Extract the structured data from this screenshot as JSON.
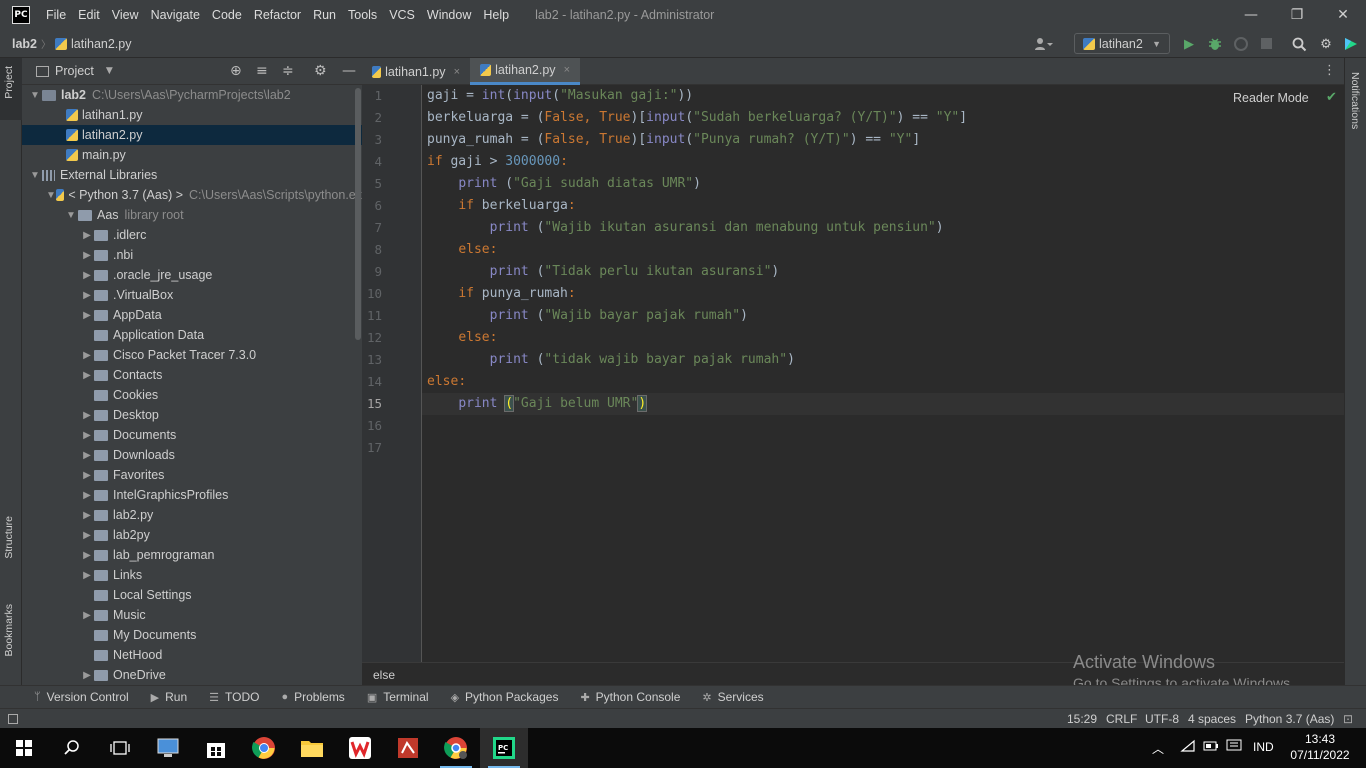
{
  "titlebar": {
    "logo": "PC",
    "menu": [
      "File",
      "Edit",
      "View",
      "Navigate",
      "Code",
      "Refactor",
      "Run",
      "Tools",
      "VCS",
      "Window",
      "Help"
    ],
    "window_title": "lab2 - latihan2.py - Administrator",
    "minimize": "—",
    "restore": "❐",
    "close": "✕"
  },
  "navbar": {
    "project": "lab2",
    "separator": "〉",
    "file": "latihan2.py",
    "run_config": "latihan2"
  },
  "left_strip": {
    "project": "Project",
    "structure": "Structure",
    "bookmarks": "Bookmarks"
  },
  "right_strip": {
    "notifications": "Notifications"
  },
  "project_panel": {
    "title": "Project",
    "rows": [
      {
        "name": "lab2",
        "path": "C:\\Users\\Aas\\PycharmProjects\\lab2"
      },
      {
        "name": "latihan1.py"
      },
      {
        "name": "latihan2.py"
      },
      {
        "name": "main.py"
      },
      {
        "name": "External Libraries"
      },
      {
        "name": "< Python 3.7 (Aas) >",
        "path": "C:\\Users\\Aas\\Scripts\\python.ex"
      },
      {
        "name": "Aas",
        "path": "library root"
      },
      {
        "name": ".idlerc"
      },
      {
        "name": ".nbi"
      },
      {
        "name": ".oracle_jre_usage"
      },
      {
        "name": ".VirtualBox"
      },
      {
        "name": "AppData"
      },
      {
        "name": "Application Data"
      },
      {
        "name": "Cisco Packet Tracer 7.3.0"
      },
      {
        "name": "Contacts"
      },
      {
        "name": "Cookies"
      },
      {
        "name": "Desktop"
      },
      {
        "name": "Documents"
      },
      {
        "name": "Downloads"
      },
      {
        "name": "Favorites"
      },
      {
        "name": "IntelGraphicsProfiles"
      },
      {
        "name": "lab2.py"
      },
      {
        "name": "lab2py"
      },
      {
        "name": "lab_pemrograman"
      },
      {
        "name": "Links"
      },
      {
        "name": "Local Settings"
      },
      {
        "name": "Music"
      },
      {
        "name": "My Documents"
      },
      {
        "name": "NetHood"
      },
      {
        "name": "OneDrive"
      }
    ]
  },
  "tabs": [
    {
      "label": "latihan1.py",
      "close": "×"
    },
    {
      "label": "latihan2.py",
      "close": "×"
    }
  ],
  "editor": {
    "reader_mode": "Reader Mode",
    "current_line": 15,
    "line_numbers": [
      "1",
      "2",
      "3",
      "4",
      "5",
      "6",
      "7",
      "8",
      "9",
      "10",
      "11",
      "12",
      "13",
      "14",
      "15",
      "16",
      "17"
    ],
    "code": [
      "gaji = int(input(\"Masukan gaji:\"))",
      "berkeluarga = (False, True)[input(\"Sudah berkeluarga? (Y/T)\") == \"Y\"]",
      "punya_rumah = (False, True)[input(\"Punya rumah? (Y/T)\") == \"Y\"]",
      "if gaji > 3000000:",
      "    print (\"Gaji sudah diatas UMR\")",
      "    if berkeluarga:",
      "        print (\"Wajib ikutan asuransi dan menabung untuk pensiun\")",
      "    else:",
      "        print (\"Tidak perlu ikutan asuransi\")",
      "    if punya_rumah:",
      "        print (\"Wajib bayar pajak rumah\")",
      "    else:",
      "        print (\"tidak wajib bayar pajak rumah\")",
      "else:",
      "    print (\"Gaji belum UMR\")",
      "",
      ""
    ],
    "breadcrumb": "else"
  },
  "tool_windows": [
    "Version Control",
    "Run",
    "TODO",
    "Problems",
    "Terminal",
    "Python Packages",
    "Python Console",
    "Services"
  ],
  "status": {
    "position": "15:29",
    "line_sep": "CRLF",
    "encoding": "UTF-8",
    "indent": "4 spaces",
    "interpreter": "Python 3.7 (Aas)"
  },
  "watermark": {
    "line1": "Activate Windows",
    "line2": "Go to Settings to activate Windows."
  },
  "taskbar": {
    "lang": "IND",
    "time": "13:43",
    "date": "07/11/2022"
  },
  "colors": {
    "accent": "#4a88c7",
    "selection": "#0d293e",
    "keyword": "#cc7832",
    "string": "#6a8759",
    "number": "#6897bb"
  }
}
